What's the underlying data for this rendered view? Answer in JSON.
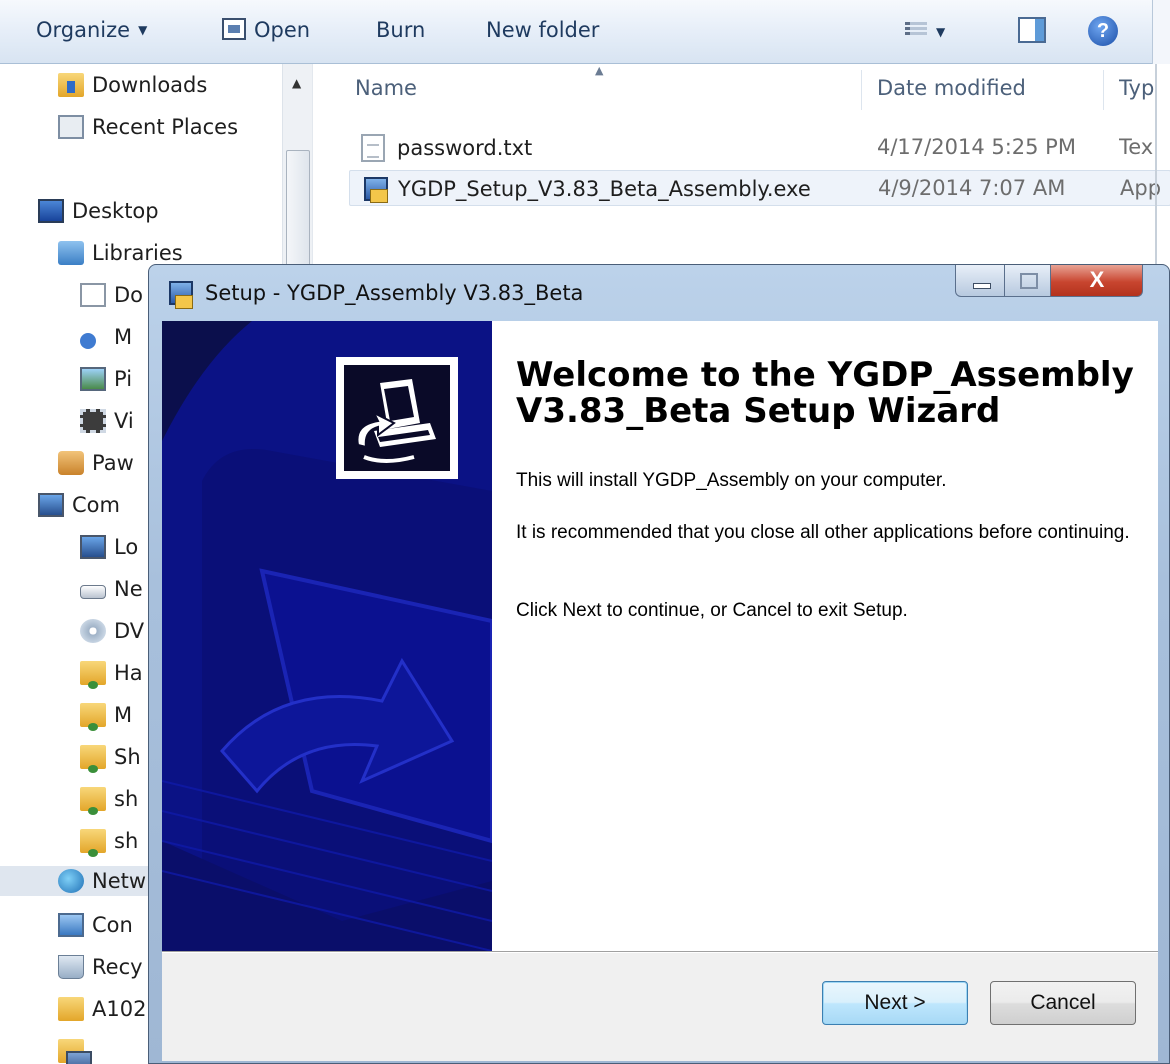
{
  "toolbar": {
    "organize": "Organize",
    "open": "Open",
    "burn": "Burn",
    "new_folder": "New folder"
  },
  "nav": {
    "items": [
      {
        "label": "Downloads",
        "icon": "downloads-folder-icon"
      },
      {
        "label": "Recent Places",
        "icon": "recent-places-icon"
      },
      {
        "label": "Desktop",
        "icon": "desktop-icon"
      },
      {
        "label": "Libraries",
        "icon": "libraries-icon"
      },
      {
        "label": "Do",
        "icon": "documents-icon"
      },
      {
        "label": "M",
        "icon": "music-icon"
      },
      {
        "label": "Pi",
        "icon": "pictures-icon"
      },
      {
        "label": "Vi",
        "icon": "videos-icon"
      },
      {
        "label": "Paw",
        "icon": "user-folder-icon"
      },
      {
        "label": "Com",
        "icon": "computer-icon"
      },
      {
        "label": "Lo",
        "icon": "local-disk-icon"
      },
      {
        "label": "Ne",
        "icon": "network-drive-icon"
      },
      {
        "label": "DV",
        "icon": "dvd-drive-icon"
      },
      {
        "label": "Ha",
        "icon": "network-folder-icon"
      },
      {
        "label": "M",
        "icon": "network-folder-icon"
      },
      {
        "label": "Sh",
        "icon": "network-folder-icon"
      },
      {
        "label": "sh",
        "icon": "network-folder-icon"
      },
      {
        "label": "sh",
        "icon": "network-folder-icon"
      },
      {
        "label": "Netw",
        "icon": "network-icon"
      },
      {
        "label": "Con",
        "icon": "control-panel-icon"
      },
      {
        "label": "Recy",
        "icon": "recycle-bin-icon"
      },
      {
        "label": "A102",
        "icon": "folder-icon"
      }
    ]
  },
  "files": {
    "columns": {
      "name": "Name",
      "date": "Date modified",
      "type": "Typ"
    },
    "rows": [
      {
        "name": "password.txt",
        "date": "4/17/2014 5:25 PM",
        "type": "Tex"
      },
      {
        "name": "YGDP_Setup_V3.83_Beta_Assembly.exe",
        "date": "4/9/2014 7:07 AM",
        "type": "App"
      }
    ]
  },
  "dialog": {
    "title": "Setup - YGDP_Assembly V3.83_Beta",
    "close_glyph": "X",
    "heading": "Welcome to the YGDP_Assembly V3.83_Beta Setup Wizard",
    "p1": "This will install YGDP_Assembly on your computer.",
    "p2": "It is recommended that you close all other applications before continuing.",
    "p3": "Click Next to continue, or Cancel to exit Setup.",
    "next": "Next >",
    "cancel": "Cancel"
  },
  "colors": {
    "banner": "#0b0f4c",
    "accent": "#3c7fb1",
    "close_red": "#c8452f"
  }
}
